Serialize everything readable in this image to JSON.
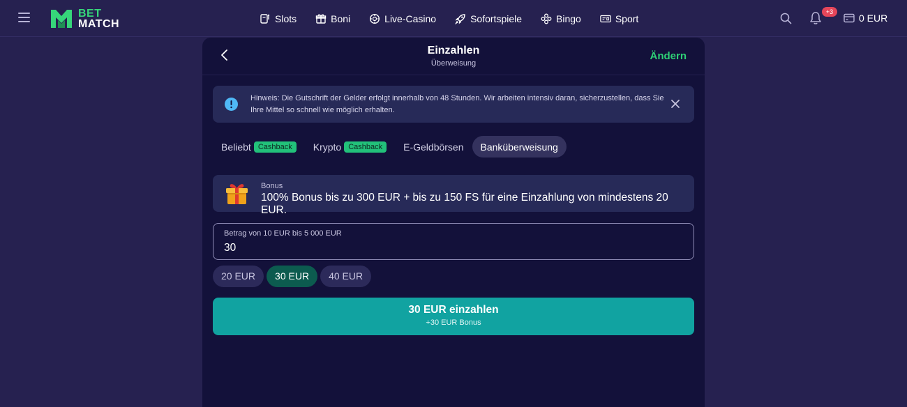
{
  "header": {
    "logo": {
      "line1": "BET",
      "line2": "MATCH"
    },
    "nav": [
      {
        "label": "Slots",
        "icon": "slot-machine-icon"
      },
      {
        "label": "Boni",
        "icon": "gift-icon"
      },
      {
        "label": "Live-Casino",
        "icon": "chip-icon"
      },
      {
        "label": "Sofortspiele",
        "icon": "rocket-icon"
      },
      {
        "label": "Bingo",
        "icon": "bingo-icon"
      },
      {
        "label": "Sport",
        "icon": "ticket-icon"
      }
    ],
    "notifications_badge": "+3",
    "balance": "0 EUR"
  },
  "panel": {
    "title": "Einzahlen",
    "subtitle": "Überweisung",
    "change_label": "Ändern",
    "notice": "Hinweis: Die Gutschrift der Gelder erfolgt innerhalb von 48 Stunden. Wir arbeiten intensiv daran, sicherzustellen, dass Sie Ihre Mittel so schnell wie möglich erhalten.",
    "tabs": [
      {
        "label": "Beliebt",
        "pill": "Cashback",
        "active": false
      },
      {
        "label": "Krypto",
        "pill": "Cashback",
        "active": false
      },
      {
        "label": "E-Geldbörsen",
        "pill": "",
        "active": false
      },
      {
        "label": "Banküberweisung",
        "pill": "",
        "active": true
      }
    ],
    "bonus": {
      "label": "Bonus",
      "text": "100% Bonus bis zu 300 EUR + bis zu 150 FS für eine Einzahlung von mindestens 20 EUR."
    },
    "amount": {
      "label": "Betrag von 10 EUR bis 5 000 EUR",
      "value": "30"
    },
    "quick_amounts": [
      {
        "label": "20 EUR",
        "active": false
      },
      {
        "label": "30 EUR",
        "active": true
      },
      {
        "label": "40 EUR",
        "active": false
      }
    ],
    "deposit_button": {
      "main": "30 EUR einzahlen",
      "sub": "+30 EUR Bonus"
    }
  },
  "colors": {
    "background": "#262150",
    "panel": "#13113a",
    "accent_green": "#2ed176",
    "button_teal": "#11a3a1",
    "badge_red": "#e5465a"
  }
}
